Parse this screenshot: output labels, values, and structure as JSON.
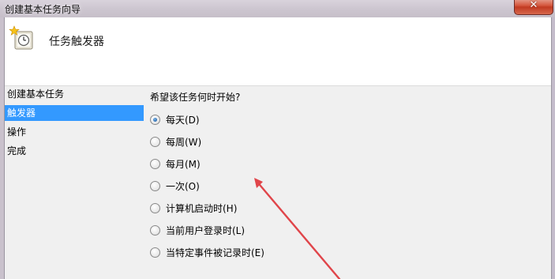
{
  "window": {
    "title": "创建基本任务向导",
    "close_label": "✕"
  },
  "header": {
    "title": "任务触发器",
    "icon": "task-clock-icon"
  },
  "nav": {
    "items": [
      {
        "label": "创建基本任务",
        "selected": false
      },
      {
        "label": "触发器",
        "selected": true
      },
      {
        "label": "操作",
        "selected": false
      },
      {
        "label": "完成",
        "selected": false
      }
    ]
  },
  "main": {
    "question": "希望该任务何时开始?",
    "options": [
      {
        "label": "每天(D)",
        "checked": true
      },
      {
        "label": "每周(W)",
        "checked": false
      },
      {
        "label": "每月(M)",
        "checked": false
      },
      {
        "label": "一次(O)",
        "checked": false
      },
      {
        "label": "计算机启动时(H)",
        "checked": false
      },
      {
        "label": "当前用户登录时(L)",
        "checked": false
      },
      {
        "label": "当特定事件被记录时(E)",
        "checked": false
      }
    ]
  },
  "colors": {
    "selection": "#3399ff",
    "annotation_arrow": "#e0454a"
  }
}
